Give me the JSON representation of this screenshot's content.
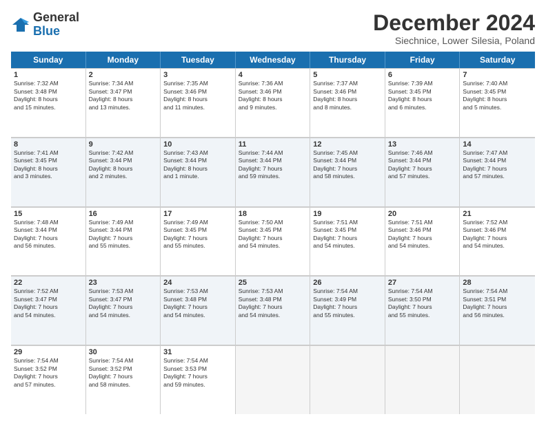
{
  "header": {
    "logo_line1": "General",
    "logo_line2": "Blue",
    "main_title": "December 2024",
    "subtitle": "Siechnice, Lower Silesia, Poland"
  },
  "days_of_week": [
    "Sunday",
    "Monday",
    "Tuesday",
    "Wednesday",
    "Thursday",
    "Friday",
    "Saturday"
  ],
  "weeks": [
    [
      {
        "num": "1",
        "lines": [
          "Sunrise: 7:32 AM",
          "Sunset: 3:48 PM",
          "Daylight: 8 hours",
          "and 15 minutes."
        ]
      },
      {
        "num": "2",
        "lines": [
          "Sunrise: 7:34 AM",
          "Sunset: 3:47 PM",
          "Daylight: 8 hours",
          "and 13 minutes."
        ]
      },
      {
        "num": "3",
        "lines": [
          "Sunrise: 7:35 AM",
          "Sunset: 3:46 PM",
          "Daylight: 8 hours",
          "and 11 minutes."
        ]
      },
      {
        "num": "4",
        "lines": [
          "Sunrise: 7:36 AM",
          "Sunset: 3:46 PM",
          "Daylight: 8 hours",
          "and 9 minutes."
        ]
      },
      {
        "num": "5",
        "lines": [
          "Sunrise: 7:37 AM",
          "Sunset: 3:46 PM",
          "Daylight: 8 hours",
          "and 8 minutes."
        ]
      },
      {
        "num": "6",
        "lines": [
          "Sunrise: 7:39 AM",
          "Sunset: 3:45 PM",
          "Daylight: 8 hours",
          "and 6 minutes."
        ]
      },
      {
        "num": "7",
        "lines": [
          "Sunrise: 7:40 AM",
          "Sunset: 3:45 PM",
          "Daylight: 8 hours",
          "and 5 minutes."
        ]
      }
    ],
    [
      {
        "num": "8",
        "lines": [
          "Sunrise: 7:41 AM",
          "Sunset: 3:45 PM",
          "Daylight: 8 hours",
          "and 3 minutes."
        ]
      },
      {
        "num": "9",
        "lines": [
          "Sunrise: 7:42 AM",
          "Sunset: 3:44 PM",
          "Daylight: 8 hours",
          "and 2 minutes."
        ]
      },
      {
        "num": "10",
        "lines": [
          "Sunrise: 7:43 AM",
          "Sunset: 3:44 PM",
          "Daylight: 8 hours",
          "and 1 minute."
        ]
      },
      {
        "num": "11",
        "lines": [
          "Sunrise: 7:44 AM",
          "Sunset: 3:44 PM",
          "Daylight: 7 hours",
          "and 59 minutes."
        ]
      },
      {
        "num": "12",
        "lines": [
          "Sunrise: 7:45 AM",
          "Sunset: 3:44 PM",
          "Daylight: 7 hours",
          "and 58 minutes."
        ]
      },
      {
        "num": "13",
        "lines": [
          "Sunrise: 7:46 AM",
          "Sunset: 3:44 PM",
          "Daylight: 7 hours",
          "and 57 minutes."
        ]
      },
      {
        "num": "14",
        "lines": [
          "Sunrise: 7:47 AM",
          "Sunset: 3:44 PM",
          "Daylight: 7 hours",
          "and 57 minutes."
        ]
      }
    ],
    [
      {
        "num": "15",
        "lines": [
          "Sunrise: 7:48 AM",
          "Sunset: 3:44 PM",
          "Daylight: 7 hours",
          "and 56 minutes."
        ]
      },
      {
        "num": "16",
        "lines": [
          "Sunrise: 7:49 AM",
          "Sunset: 3:44 PM",
          "Daylight: 7 hours",
          "and 55 minutes."
        ]
      },
      {
        "num": "17",
        "lines": [
          "Sunrise: 7:49 AM",
          "Sunset: 3:45 PM",
          "Daylight: 7 hours",
          "and 55 minutes."
        ]
      },
      {
        "num": "18",
        "lines": [
          "Sunrise: 7:50 AM",
          "Sunset: 3:45 PM",
          "Daylight: 7 hours",
          "and 54 minutes."
        ]
      },
      {
        "num": "19",
        "lines": [
          "Sunrise: 7:51 AM",
          "Sunset: 3:45 PM",
          "Daylight: 7 hours",
          "and 54 minutes."
        ]
      },
      {
        "num": "20",
        "lines": [
          "Sunrise: 7:51 AM",
          "Sunset: 3:46 PM",
          "Daylight: 7 hours",
          "and 54 minutes."
        ]
      },
      {
        "num": "21",
        "lines": [
          "Sunrise: 7:52 AM",
          "Sunset: 3:46 PM",
          "Daylight: 7 hours",
          "and 54 minutes."
        ]
      }
    ],
    [
      {
        "num": "22",
        "lines": [
          "Sunrise: 7:52 AM",
          "Sunset: 3:47 PM",
          "Daylight: 7 hours",
          "and 54 minutes."
        ]
      },
      {
        "num": "23",
        "lines": [
          "Sunrise: 7:53 AM",
          "Sunset: 3:47 PM",
          "Daylight: 7 hours",
          "and 54 minutes."
        ]
      },
      {
        "num": "24",
        "lines": [
          "Sunrise: 7:53 AM",
          "Sunset: 3:48 PM",
          "Daylight: 7 hours",
          "and 54 minutes."
        ]
      },
      {
        "num": "25",
        "lines": [
          "Sunrise: 7:53 AM",
          "Sunset: 3:48 PM",
          "Daylight: 7 hours",
          "and 54 minutes."
        ]
      },
      {
        "num": "26",
        "lines": [
          "Sunrise: 7:54 AM",
          "Sunset: 3:49 PM",
          "Daylight: 7 hours",
          "and 55 minutes."
        ]
      },
      {
        "num": "27",
        "lines": [
          "Sunrise: 7:54 AM",
          "Sunset: 3:50 PM",
          "Daylight: 7 hours",
          "and 55 minutes."
        ]
      },
      {
        "num": "28",
        "lines": [
          "Sunrise: 7:54 AM",
          "Sunset: 3:51 PM",
          "Daylight: 7 hours",
          "and 56 minutes."
        ]
      }
    ],
    [
      {
        "num": "29",
        "lines": [
          "Sunrise: 7:54 AM",
          "Sunset: 3:52 PM",
          "Daylight: 7 hours",
          "and 57 minutes."
        ]
      },
      {
        "num": "30",
        "lines": [
          "Sunrise: 7:54 AM",
          "Sunset: 3:52 PM",
          "Daylight: 7 hours",
          "and 58 minutes."
        ]
      },
      {
        "num": "31",
        "lines": [
          "Sunrise: 7:54 AM",
          "Sunset: 3:53 PM",
          "Daylight: 7 hours",
          "and 59 minutes."
        ]
      },
      null,
      null,
      null,
      null
    ]
  ],
  "alt_rows": [
    1,
    3
  ]
}
